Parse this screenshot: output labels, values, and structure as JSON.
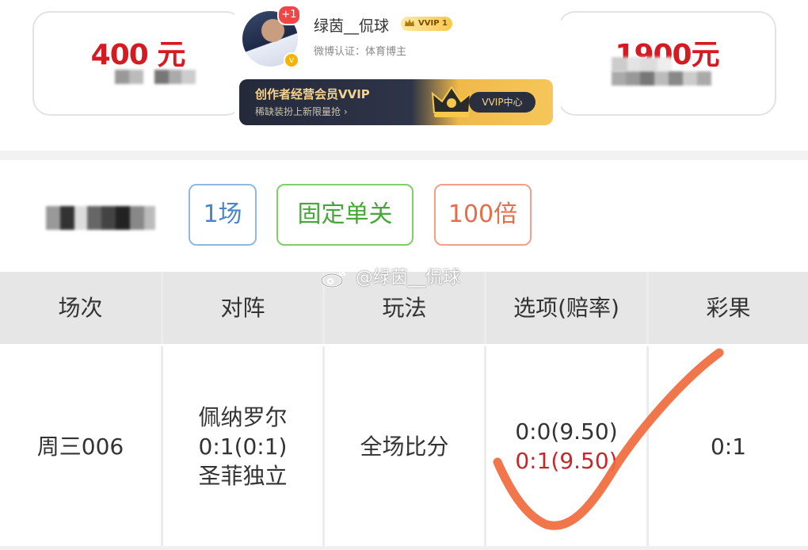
{
  "cards": {
    "left_amount": "400 元",
    "right_amount": "1900元"
  },
  "profile": {
    "notification_badge": "+1",
    "username": "绿茵__侃球",
    "vip_badge": "VVIP 1",
    "certification": "微博认证：体育博主",
    "banner_title": "创作者经营会员VVIP",
    "banner_subtitle": "稀缺装扮上新限量抢 ›",
    "banner_button": "VVIP中心"
  },
  "filters": {
    "matches": "1场",
    "bet_type": "固定单关",
    "multiplier": "100倍"
  },
  "table": {
    "headers": [
      "场次",
      "对阵",
      "玩法",
      "选项(赔率)",
      "彩果"
    ],
    "row": {
      "match_no": "周三006",
      "home": "佩纳罗尔",
      "score": "0:1(0:1)",
      "away": "圣菲独立",
      "play": "全场比分",
      "option1": "0:0(9.50)",
      "option2": "0:1(9.50)",
      "result": "0:1"
    }
  },
  "watermark": "@绿茵__侃球",
  "colors": {
    "amount_red": "#d51a22",
    "check_orange": "#f06a3c",
    "odds_red": "#c8262c"
  }
}
